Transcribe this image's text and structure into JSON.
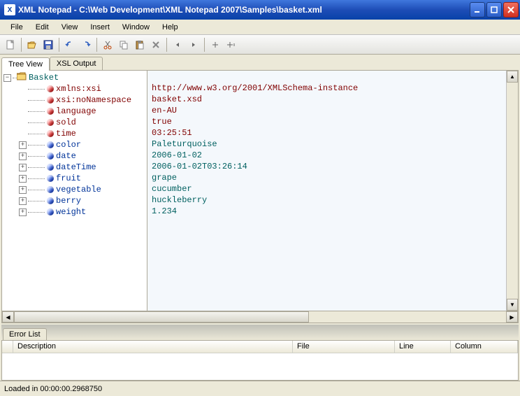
{
  "title": "XML Notepad - C:\\Web Development\\XML Notepad 2007\\Samples\\basket.xml",
  "menu": {
    "items": [
      "File",
      "Edit",
      "View",
      "Insert",
      "Window",
      "Help"
    ]
  },
  "tabs": {
    "tree": "Tree View",
    "xsl": "XSL Output"
  },
  "tree": {
    "root": "Basket",
    "attributes": [
      {
        "name": "xmlns:xsi",
        "value": "http://www.w3.org/2001/XMLSchema-instance"
      },
      {
        "name": "xsi:noNamespace",
        "value": "basket.xsd"
      },
      {
        "name": "language",
        "value": "en-AU"
      },
      {
        "name": "sold",
        "value": "true"
      },
      {
        "name": "time",
        "value": "03:25:51"
      }
    ],
    "elements": [
      {
        "name": "color",
        "value": "Paleturquoise"
      },
      {
        "name": "date",
        "value": "2006-01-02"
      },
      {
        "name": "dateTime",
        "value": "2006-01-02T03:26:14"
      },
      {
        "name": "fruit",
        "value": "grape"
      },
      {
        "name": "vegetable",
        "value": "cucumber"
      },
      {
        "name": "berry",
        "value": "huckleberry"
      },
      {
        "name": "weight",
        "value": "1.234"
      }
    ]
  },
  "error_tab": "Error List",
  "error_cols": {
    "description": "Description",
    "file": "File",
    "line": "Line",
    "column": "Column"
  },
  "status": "Loaded in 00:00:00.2968750"
}
